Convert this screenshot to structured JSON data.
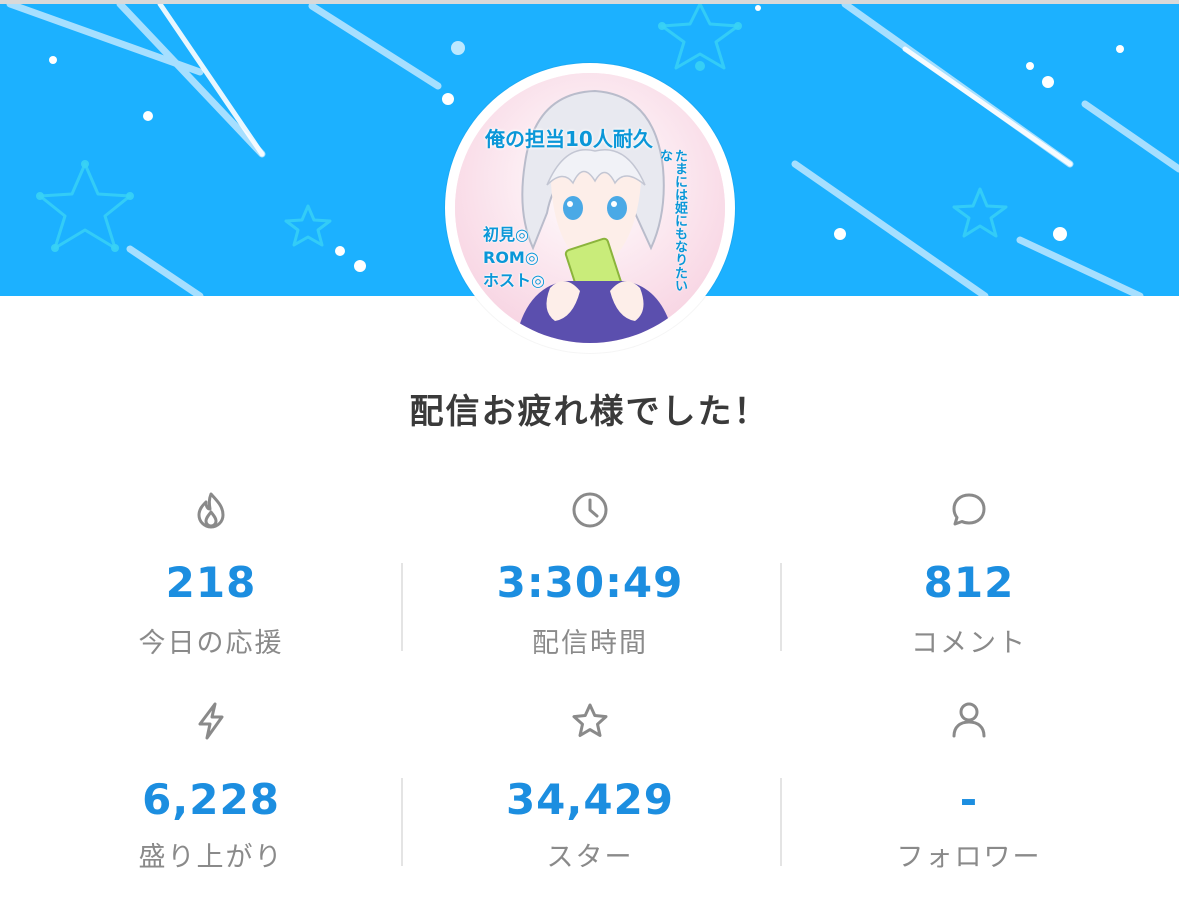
{
  "banner": {
    "color": "#1cb1ff",
    "decor": [
      "shooting-star-lines",
      "star-outline-icon",
      "dot-decor"
    ]
  },
  "avatar": {
    "caption_top": "俺の担当10人耐久",
    "caption_side": "たまには姫にもなりたいな",
    "caption_left": [
      "初見◎",
      "ROM◎",
      "ホスト◎"
    ]
  },
  "headline": "配信お疲れ様でした！",
  "stats": [
    {
      "icon": "flame-icon",
      "value": "218",
      "label": "今日の応援"
    },
    {
      "icon": "clock-icon",
      "value": "3:30:49",
      "label": "配信時間"
    },
    {
      "icon": "comment-bubble-icon",
      "value": "812",
      "label": "コメント"
    },
    {
      "icon": "lightning-icon",
      "value": "6,228",
      "label": "盛り上がり"
    },
    {
      "icon": "star-icon",
      "value": "34,429",
      "label": "スター"
    },
    {
      "icon": "person-icon",
      "value": "-",
      "label": "フォロワー"
    }
  ],
  "colors": {
    "accent": "#1c8ee0",
    "label": "#8a8a8a",
    "icon": "#8a8a8a",
    "headline": "#3a3a3a"
  }
}
